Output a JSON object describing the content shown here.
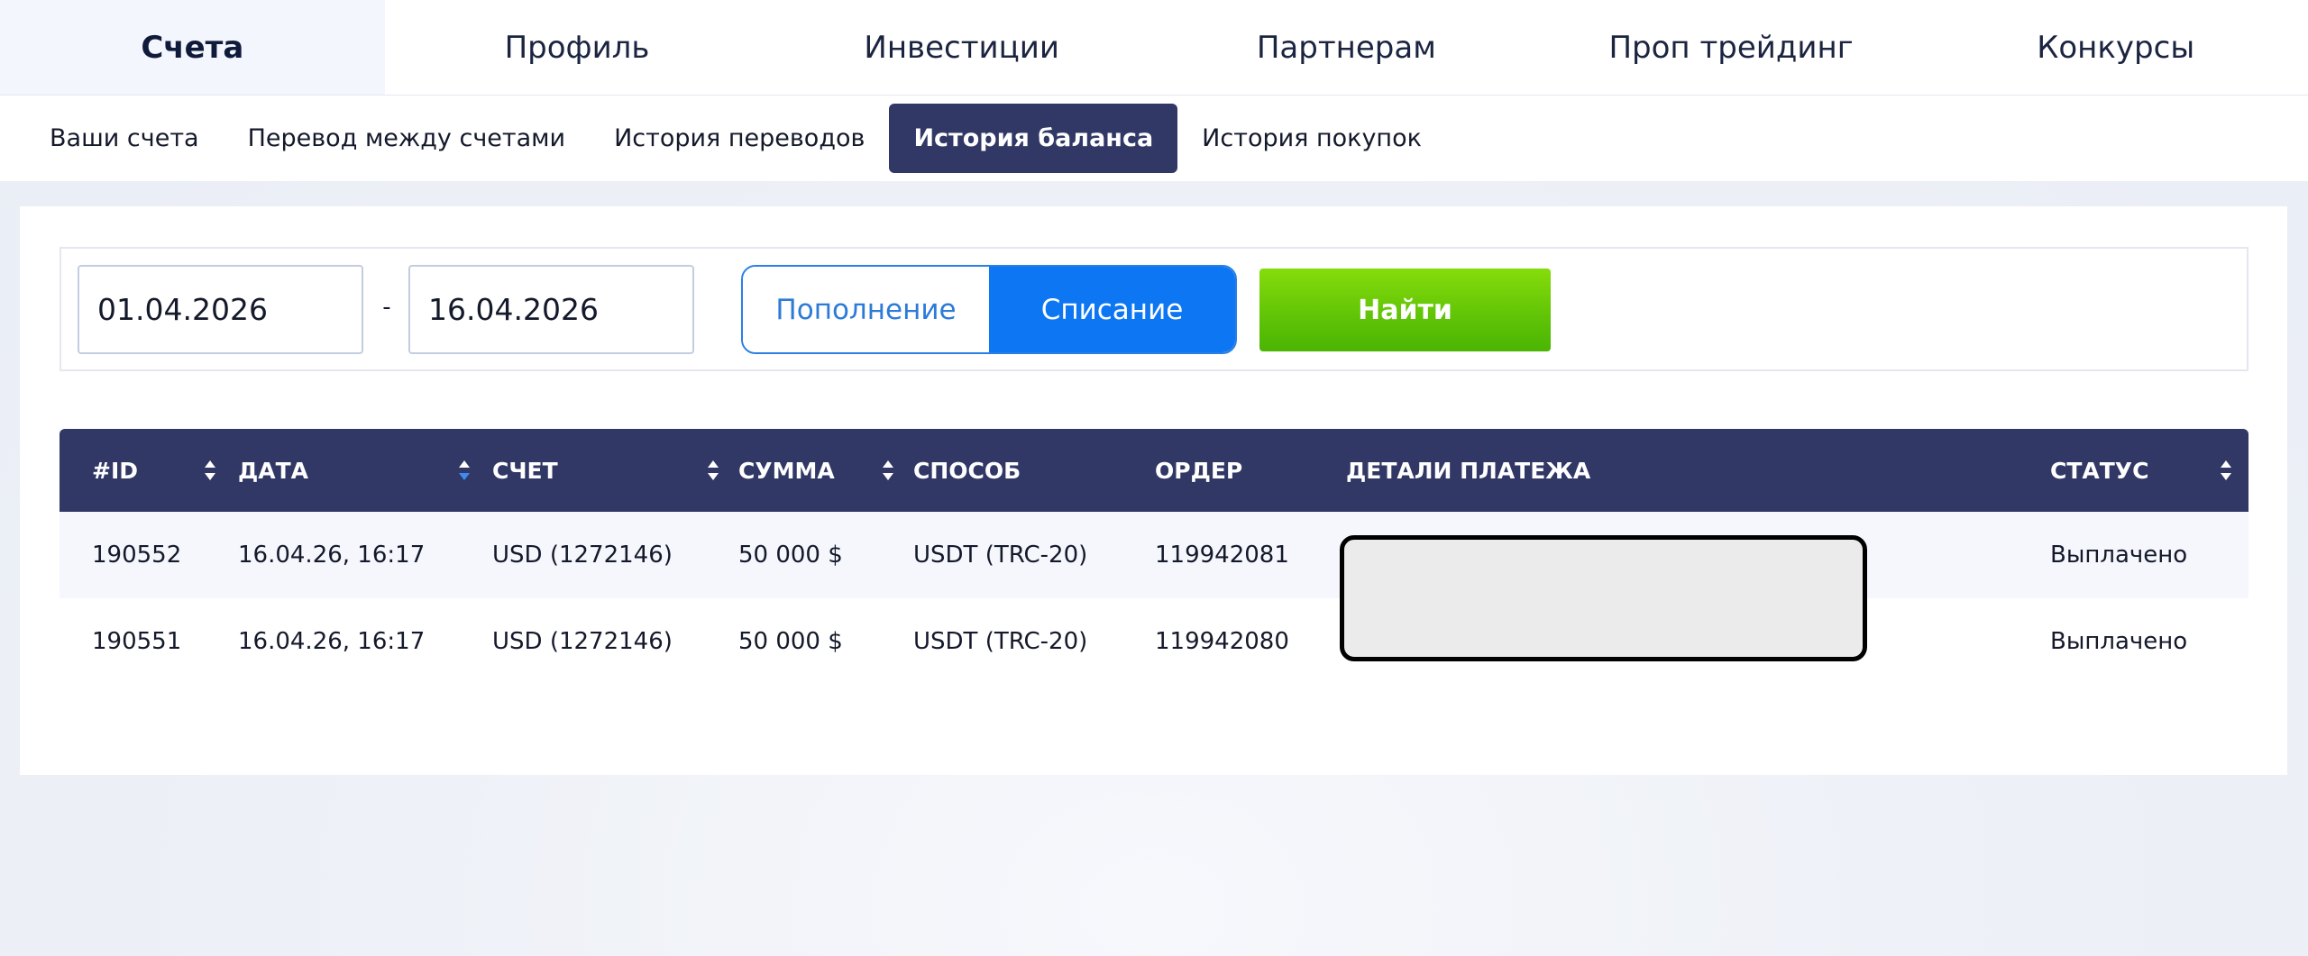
{
  "top_nav": {
    "tabs": [
      {
        "label": "Счета",
        "active": true
      },
      {
        "label": "Профиль",
        "active": false
      },
      {
        "label": "Инвестиции",
        "active": false
      },
      {
        "label": "Партнерам",
        "active": false
      },
      {
        "label": "Проп трейдинг",
        "active": false
      },
      {
        "label": "Конкурсы",
        "active": false
      }
    ]
  },
  "sub_nav": {
    "tabs": [
      {
        "label": "Ваши счета",
        "active": false
      },
      {
        "label": "Перевод между счетами",
        "active": false
      },
      {
        "label": "История переводов",
        "active": false
      },
      {
        "label": "История баланса",
        "active": true
      },
      {
        "label": "История покупок",
        "active": false
      }
    ]
  },
  "filters": {
    "date_from": "01.04.2026",
    "separator": "-",
    "date_to": "16.04.2026",
    "type_options": [
      {
        "label": "Пополнение",
        "selected": false
      },
      {
        "label": "Списание",
        "selected": true
      }
    ],
    "find_label": "Найти"
  },
  "table": {
    "columns": [
      {
        "label": "#ID",
        "sortable": true,
        "sort_active": "none"
      },
      {
        "label": "ДАТА",
        "sortable": true,
        "sort_active": "desc"
      },
      {
        "label": "СЧЕТ",
        "sortable": true,
        "sort_active": "none"
      },
      {
        "label": "СУММА",
        "sortable": true,
        "sort_active": "none"
      },
      {
        "label": "СПОСОБ",
        "sortable": false
      },
      {
        "label": "ОРДЕР",
        "sortable": false
      },
      {
        "label": "ДЕТАЛИ ПЛАТЕЖА",
        "sortable": false
      },
      {
        "label": "СТАТУС",
        "sortable": true,
        "sort_active": "none"
      }
    ],
    "rows": [
      {
        "id": "190552",
        "date": "16.04.26, 16:17",
        "account": "USD (1272146)",
        "amount": "50 000 $",
        "method": "USDT (TRC-20)",
        "order": "119942081",
        "details": "",
        "status": "Выплачено"
      },
      {
        "id": "190551",
        "date": "16.04.26, 16:17",
        "account": "USD (1272146)",
        "amount": "50 000 $",
        "method": "USDT (TRC-20)",
        "order": "119942080",
        "details": "",
        "status": "Выплачено"
      }
    ]
  },
  "colors": {
    "header_navy": "#313865",
    "active_blue": "#0d76f2",
    "find_green": "#62c506",
    "sort_active_blue": "#3d8bf0"
  }
}
